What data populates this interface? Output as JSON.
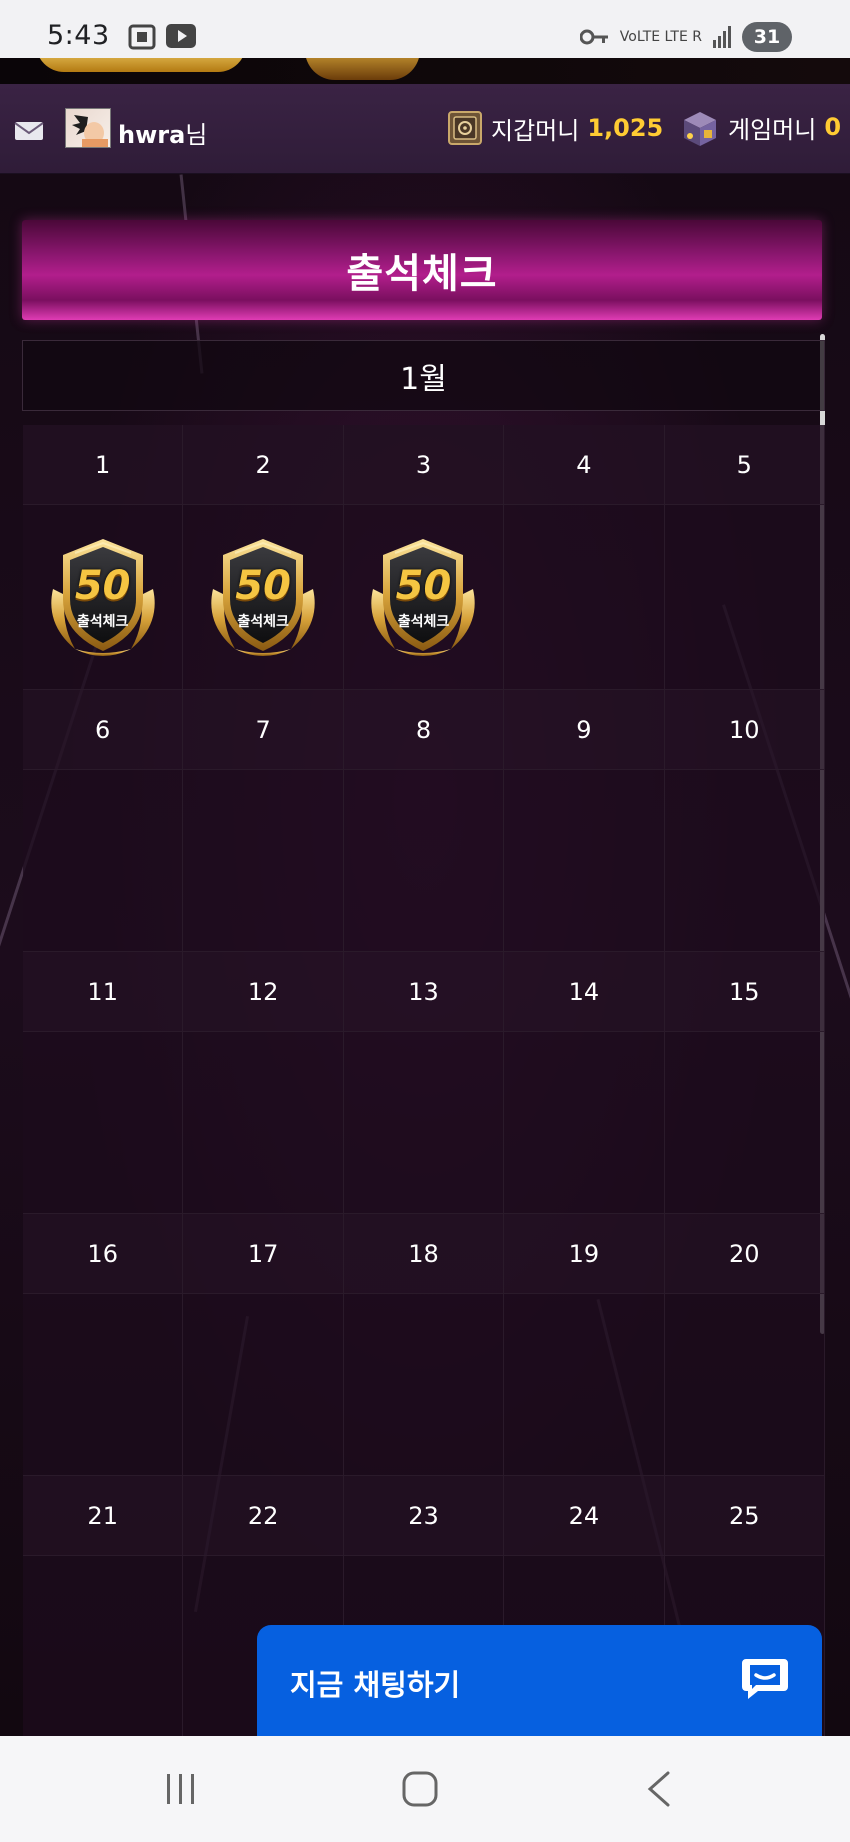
{
  "status_bar": {
    "time": "5:43",
    "network": "VoLTE LTE R",
    "battery": "31"
  },
  "user": {
    "name": "hwra",
    "suffix": "님"
  },
  "wallet": {
    "label": "지갑머니",
    "value": "1,025"
  },
  "game": {
    "label": "게임머니",
    "value": "0"
  },
  "page": {
    "title": "출석체크",
    "month": "1월"
  },
  "calendar": {
    "weeks": [
      {
        "days": [
          "1",
          "2",
          "3",
          "4",
          "5"
        ],
        "stamps": [
          true,
          true,
          true,
          false,
          false
        ]
      },
      {
        "days": [
          "6",
          "7",
          "8",
          "9",
          "10"
        ],
        "stamps": [
          false,
          false,
          false,
          false,
          false
        ]
      },
      {
        "days": [
          "11",
          "12",
          "13",
          "14",
          "15"
        ],
        "stamps": [
          false,
          false,
          false,
          false,
          false
        ]
      },
      {
        "days": [
          "16",
          "17",
          "18",
          "19",
          "20"
        ],
        "stamps": [
          false,
          false,
          false,
          false,
          false
        ]
      },
      {
        "days": [
          "21",
          "22",
          "23",
          "24",
          "25"
        ],
        "stamps": [
          false,
          false,
          false,
          false,
          false
        ]
      }
    ],
    "stamp_badge": {
      "number": "50",
      "label": "출석체크"
    }
  },
  "chat": {
    "label": "지금 채팅하기"
  },
  "icons": {
    "mail": "mail-icon",
    "wallet": "safe-icon",
    "game": "treasure-box-icon",
    "chat": "chat-bubble-icon"
  },
  "colors": {
    "accent_gold": "#ffcc33",
    "banner_pink": "#b21e8c",
    "chat_blue": "#0660e0"
  }
}
